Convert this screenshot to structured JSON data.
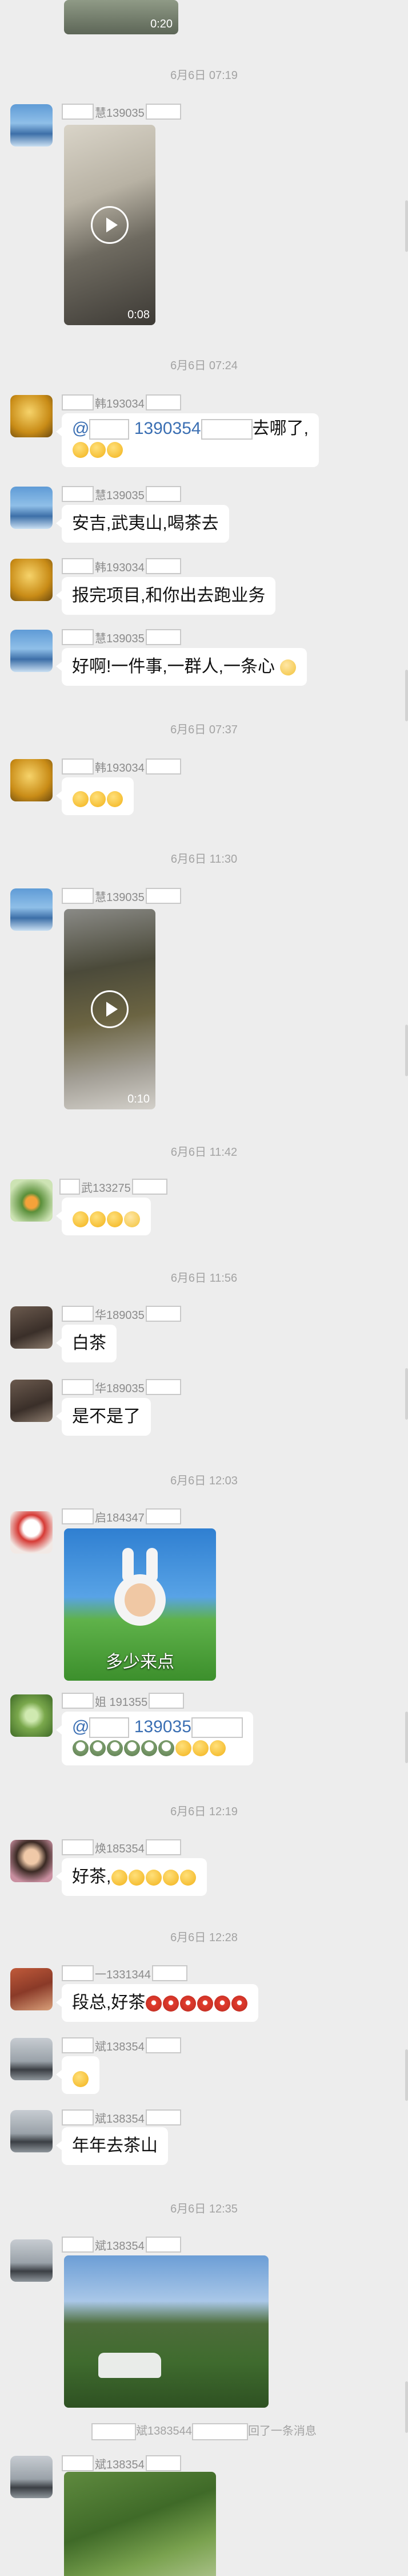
{
  "timestamps": [
    "6月6日 07:19",
    "6月6日 07:24",
    "6月6日 07:37",
    "6月6日 11:30",
    "6月6日 11:42",
    "6月6日 11:56",
    "6月6日 12:03",
    "6月6日 12:19",
    "6月6日 12:28",
    "6月6日 12:35"
  ],
  "durations": {
    "v0": "0:20",
    "v1": "0:08",
    "v2": "0:10"
  },
  "names": [
    "慧139035",
    "韩193034",
    "慧139035",
    "韩193034",
    "慧139035",
    "韩193034",
    "慧139035",
    "武133275",
    "华189035",
    "华189035",
    "启184347",
    "姐 191355",
    "焕185354",
    "一1331344",
    "斌138354",
    "斌138354",
    "斌138354",
    "斌138354"
  ],
  "messages": {
    "m2_mention": "@",
    "m2_mention_num": "1390354",
    "m2_text": "去哪了,",
    "m3": "安吉,武夷山,喝茶去",
    "m4": "报完项目,和你出去跑业务",
    "m5": "好啊!一件事,一群人,一条心",
    "m10": "白茶",
    "m11": "是不是了",
    "sticker_caption": "多少来点",
    "m13_mention": "@",
    "m13_mention_num": "139035",
    "m14": "好茶,",
    "m15": "段总,好茶",
    "m17": "年年去茶山"
  },
  "system": {
    "recall_name": "斌1383544",
    "recall_text": "回了一条消息"
  },
  "colors": {
    "bg": "#ededed",
    "bubble": "#ffffff",
    "mention": "#3b6fb3",
    "timestamp": "#a3a3a3"
  }
}
